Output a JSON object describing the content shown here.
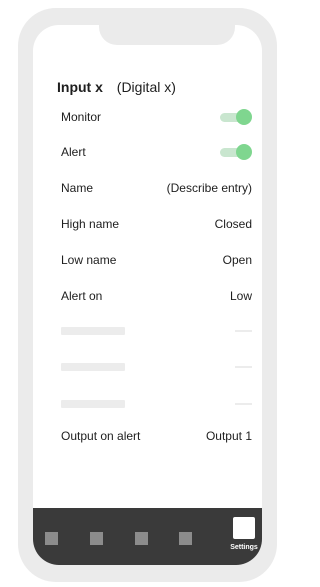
{
  "header": {
    "title": "Input x",
    "subtitle": "(Digital x)"
  },
  "settings": {
    "monitor": {
      "label": "Monitor",
      "enabled": true
    },
    "alert": {
      "label": "Alert",
      "enabled": true
    },
    "name": {
      "label": "Name",
      "value": "(Describe entry)"
    },
    "high_name": {
      "label": "High name",
      "value": "Closed"
    },
    "low_name": {
      "label": "Low name",
      "value": "Open"
    },
    "alert_on": {
      "label": "Alert on",
      "value": "Low"
    },
    "output_on_alert": {
      "label": "Output on alert",
      "value": "Output 1"
    }
  },
  "tabbar": {
    "settings_label": "Settings"
  },
  "colors": {
    "toggle_on_knob": "#7fd68f",
    "toggle_on_track": "#c9e6cf",
    "tabbar_bg": "#3a3a3a",
    "frame": "#ebebeb"
  }
}
